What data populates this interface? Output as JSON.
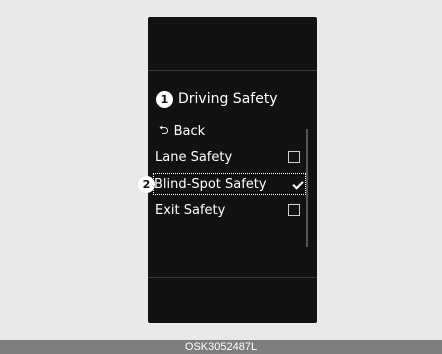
{
  "menu": {
    "callout_1": "1",
    "title": "Driving Safety",
    "back_label": "Back",
    "back_icon": "back-arrow-icon",
    "options": [
      {
        "label": "Lane Safety",
        "checked": false
      },
      {
        "label": "Blind-Spot Safety",
        "checked": true
      },
      {
        "label": "Exit Safety",
        "checked": false
      }
    ]
  },
  "callout_2": "2",
  "caption": "OSK3052487L",
  "colors": {
    "screen_bg": "#121212",
    "page_bg": "#e9e9e9",
    "caption_bar": "#7e7e7e",
    "text": "#ffffff"
  }
}
